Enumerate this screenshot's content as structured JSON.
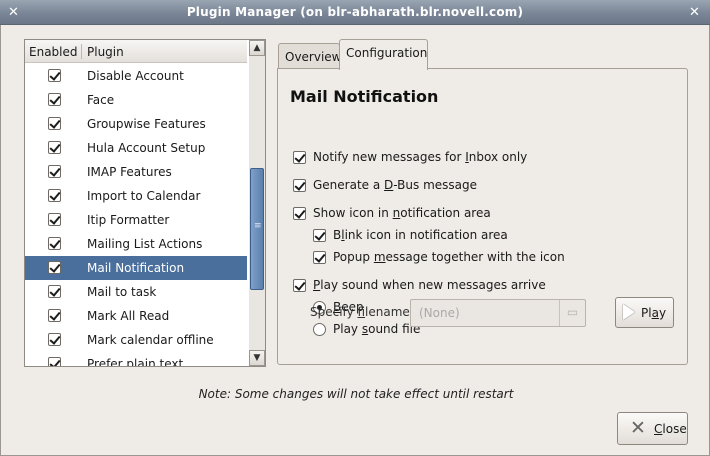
{
  "window": {
    "title": "Plugin Manager (on blr-abharath.blr.novell.com)"
  },
  "plugin_list": {
    "col_enabled": "Enabled",
    "col_plugin": "Plugin",
    "items": [
      {
        "label": "Disable Account",
        "enabled": true
      },
      {
        "label": "Face",
        "enabled": true
      },
      {
        "label": "Groupwise Features",
        "enabled": true
      },
      {
        "label": "Hula Account Setup",
        "enabled": true
      },
      {
        "label": "IMAP Features",
        "enabled": true
      },
      {
        "label": "Import to Calendar",
        "enabled": true
      },
      {
        "label": "Itip Formatter",
        "enabled": true
      },
      {
        "label": "Mailing List Actions",
        "enabled": true
      },
      {
        "label": "Mail Notification",
        "enabled": true,
        "selected": true
      },
      {
        "label": "Mail to task",
        "enabled": true
      },
      {
        "label": "Mark All Read",
        "enabled": true
      },
      {
        "label": "Mark calendar offline",
        "enabled": true
      },
      {
        "label": "Prefer plain text",
        "enabled": true
      }
    ]
  },
  "tabs": [
    {
      "label": "Overview",
      "active": false
    },
    {
      "label": "Configuration",
      "active": true
    }
  ],
  "config": {
    "title": "Mail Notification",
    "opt_inbox_only": {
      "pre": "Notify new messages for ",
      "key": "I",
      "post": "nbox only",
      "checked": true
    },
    "opt_dbus": {
      "pre": "Generate a ",
      "key": "D",
      "post": "-Bus message",
      "checked": true
    },
    "opt_show_icon": {
      "pre": "Show icon in ",
      "key": "n",
      "post": "otification area",
      "checked": true
    },
    "opt_blink": {
      "pre": "B",
      "key": "l",
      "post": "ink icon in notification area",
      "checked": true
    },
    "opt_popup": {
      "pre": "Popup ",
      "key": "m",
      "post": "essage together with the icon",
      "checked": true
    },
    "opt_play_sound": {
      "pre": "",
      "key": "P",
      "post": "lay sound when new messages arrive",
      "checked": true
    },
    "radio_beep": {
      "pre": "",
      "key": "B",
      "post": "eep",
      "selected": true
    },
    "radio_file": {
      "pre": "Play ",
      "key": "s",
      "post": "ound file",
      "selected": false
    },
    "filename_label": {
      "pre": "Specify ",
      "key": "f",
      "post": "ilename:"
    },
    "filename_value": "(None)",
    "play_button": {
      "pre": "Pl",
      "key": "a",
      "post": "y"
    }
  },
  "note": "Note: Some changes will not take effect until restart",
  "close_button": {
    "pre": "",
    "key": "C",
    "post": "lose"
  },
  "icons": {
    "window_menu": "window-menu-icon",
    "window_close": "close-icon",
    "folder": "folder-icon",
    "play": "play-icon",
    "close": "x-icon"
  }
}
